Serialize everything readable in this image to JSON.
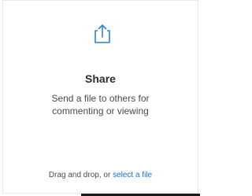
{
  "card": {
    "icon": "share-upload-icon",
    "title": "Share",
    "description_line1": "Send a file to others for",
    "description_line2": "commenting or viewing",
    "drop_text": "Drag and drop, or ",
    "select_link": "select a file"
  },
  "colors": {
    "icon_blue": "#2d80d6",
    "link_blue": "#1473e6",
    "title": "#2c2c2c",
    "text": "#4b4b4b"
  }
}
